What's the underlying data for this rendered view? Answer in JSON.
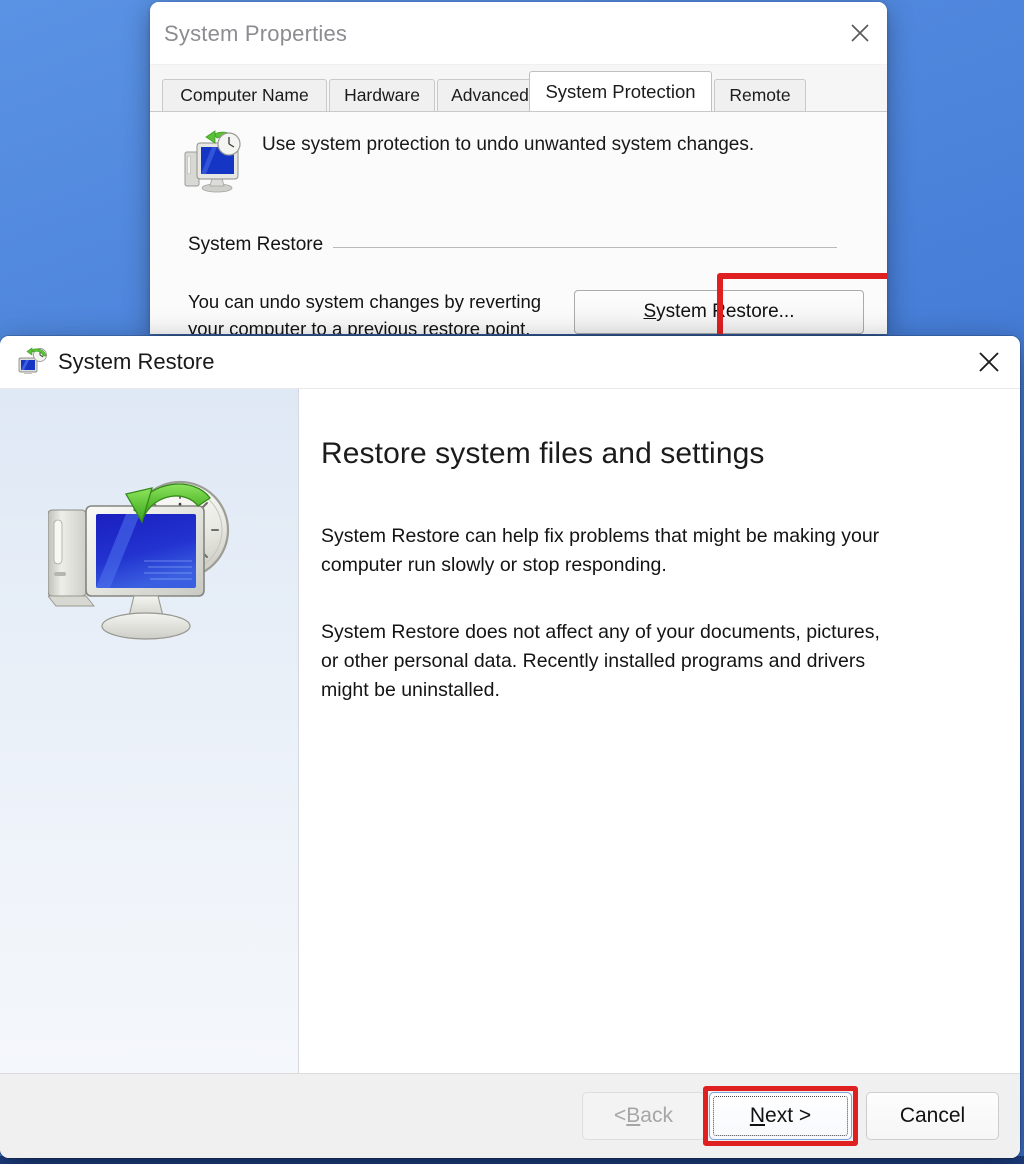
{
  "desktop": {
    "background_color": "#4a86de"
  },
  "system_properties": {
    "title": "System Properties",
    "close_icon": "close-icon",
    "tabs": [
      {
        "label": "Computer Name",
        "active": false
      },
      {
        "label": "Hardware",
        "active": false
      },
      {
        "label": "Advanced",
        "active": false
      },
      {
        "label": "System Protection",
        "active": true
      },
      {
        "label": "Remote",
        "active": false
      }
    ],
    "hero_icon": "system-protection-monitor-icon",
    "hero_text": "Use system protection to undo unwanted system changes.",
    "group": {
      "label": "System Restore",
      "description_line1": "You can undo system changes by reverting",
      "description_line2": "your computer to a previous restore point.",
      "button": {
        "accel": "S",
        "rest": "ystem Restore...",
        "full_label": "System Restore...",
        "highlighted": true,
        "highlight_color": "#e02020"
      }
    }
  },
  "system_restore": {
    "title": "System Restore",
    "title_icon": "system-restore-monitor-clock-icon",
    "close_icon": "close-icon",
    "sidebar": {
      "illustration": "monitor-clock-green-arrow-illustration"
    },
    "main": {
      "heading": "Restore system files and settings",
      "paragraph1": "System Restore can help fix problems that might be making your computer run slowly or stop responding.",
      "paragraph2": "System Restore does not affect any of your documents, pictures, or other personal data. Recently installed programs and drivers might be uninstalled."
    },
    "footer": {
      "back": {
        "prefix": "< ",
        "accel": "B",
        "rest": "ack",
        "full_label": "< Back",
        "disabled": true
      },
      "next": {
        "accel": "N",
        "rest": "ext >",
        "full_label": "Next >",
        "default": true,
        "focused": true,
        "highlighted": true,
        "highlight_color": "#e02020"
      },
      "cancel": {
        "full_label": "Cancel",
        "disabled": false
      }
    }
  }
}
